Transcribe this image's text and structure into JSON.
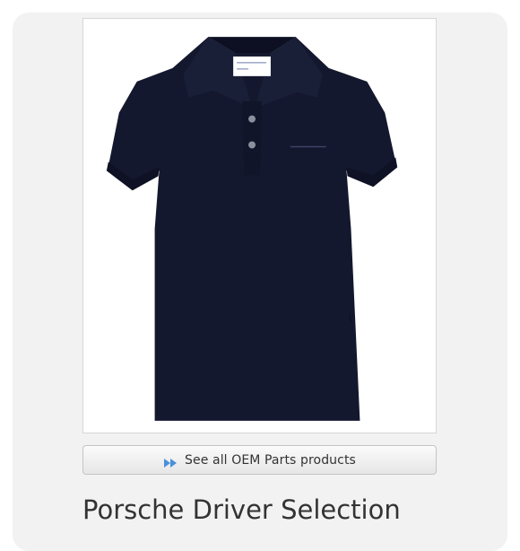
{
  "product": {
    "image_alt": "Navy blue women's polo shirt",
    "image_brand_mark": "PORSCHE",
    "image_tag_text": "Made in Italy",
    "image_size_tag": "XS",
    "title": "Porsche Driver Selection"
  },
  "actions": {
    "see_all_label": "See all OEM Parts products",
    "see_all_icon": "fast-forward-icon",
    "icon_color": "#4a90d9"
  },
  "colors": {
    "shirt": "#14182e",
    "card_background": "#f2f2f2"
  }
}
